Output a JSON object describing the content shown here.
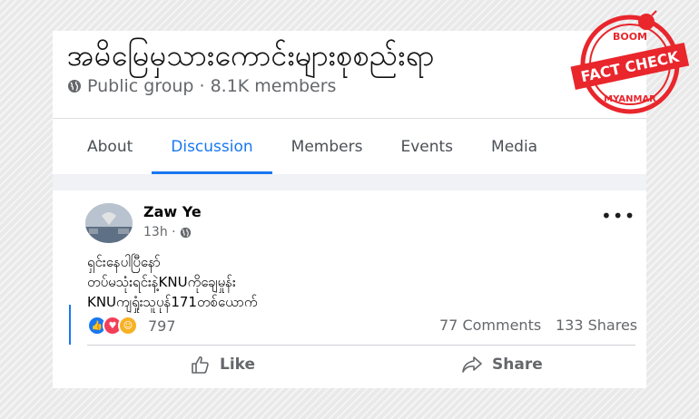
{
  "group": {
    "name": "အမိမြေမှသားကောင်းများစုစည်းရာ",
    "privacy_icon": "globe-icon",
    "meta": "Public group · 8.1K members"
  },
  "tabs": [
    {
      "label": "About",
      "active": false
    },
    {
      "label": "Discussion",
      "active": true
    },
    {
      "label": "Members",
      "active": false
    },
    {
      "label": "Events",
      "active": false
    },
    {
      "label": "Media",
      "active": false
    }
  ],
  "post": {
    "author": "Zaw Ye",
    "time": "13h ·",
    "more_icon": "more-options-icon",
    "text_lines": [
      "ရှင်းနေပါပြီနော်",
      "တပ်မသုံးရင်းနဲ့KNUကိုချေမှုန်း",
      "KNUကျရှုံးသူပုန်171တစ်ယောက်"
    ],
    "reaction_count": "797",
    "comments": "77 Comments",
    "shares": "133 Shares",
    "like_label": "Like",
    "share_label": "Share"
  },
  "badge": {
    "top_text": "BOOM",
    "main_text": "FACT CHECK",
    "bottom_text": "MYANMAR",
    "color": "#e8262c"
  },
  "colors": {
    "accent": "#1877f2",
    "muted": "#65676b"
  }
}
